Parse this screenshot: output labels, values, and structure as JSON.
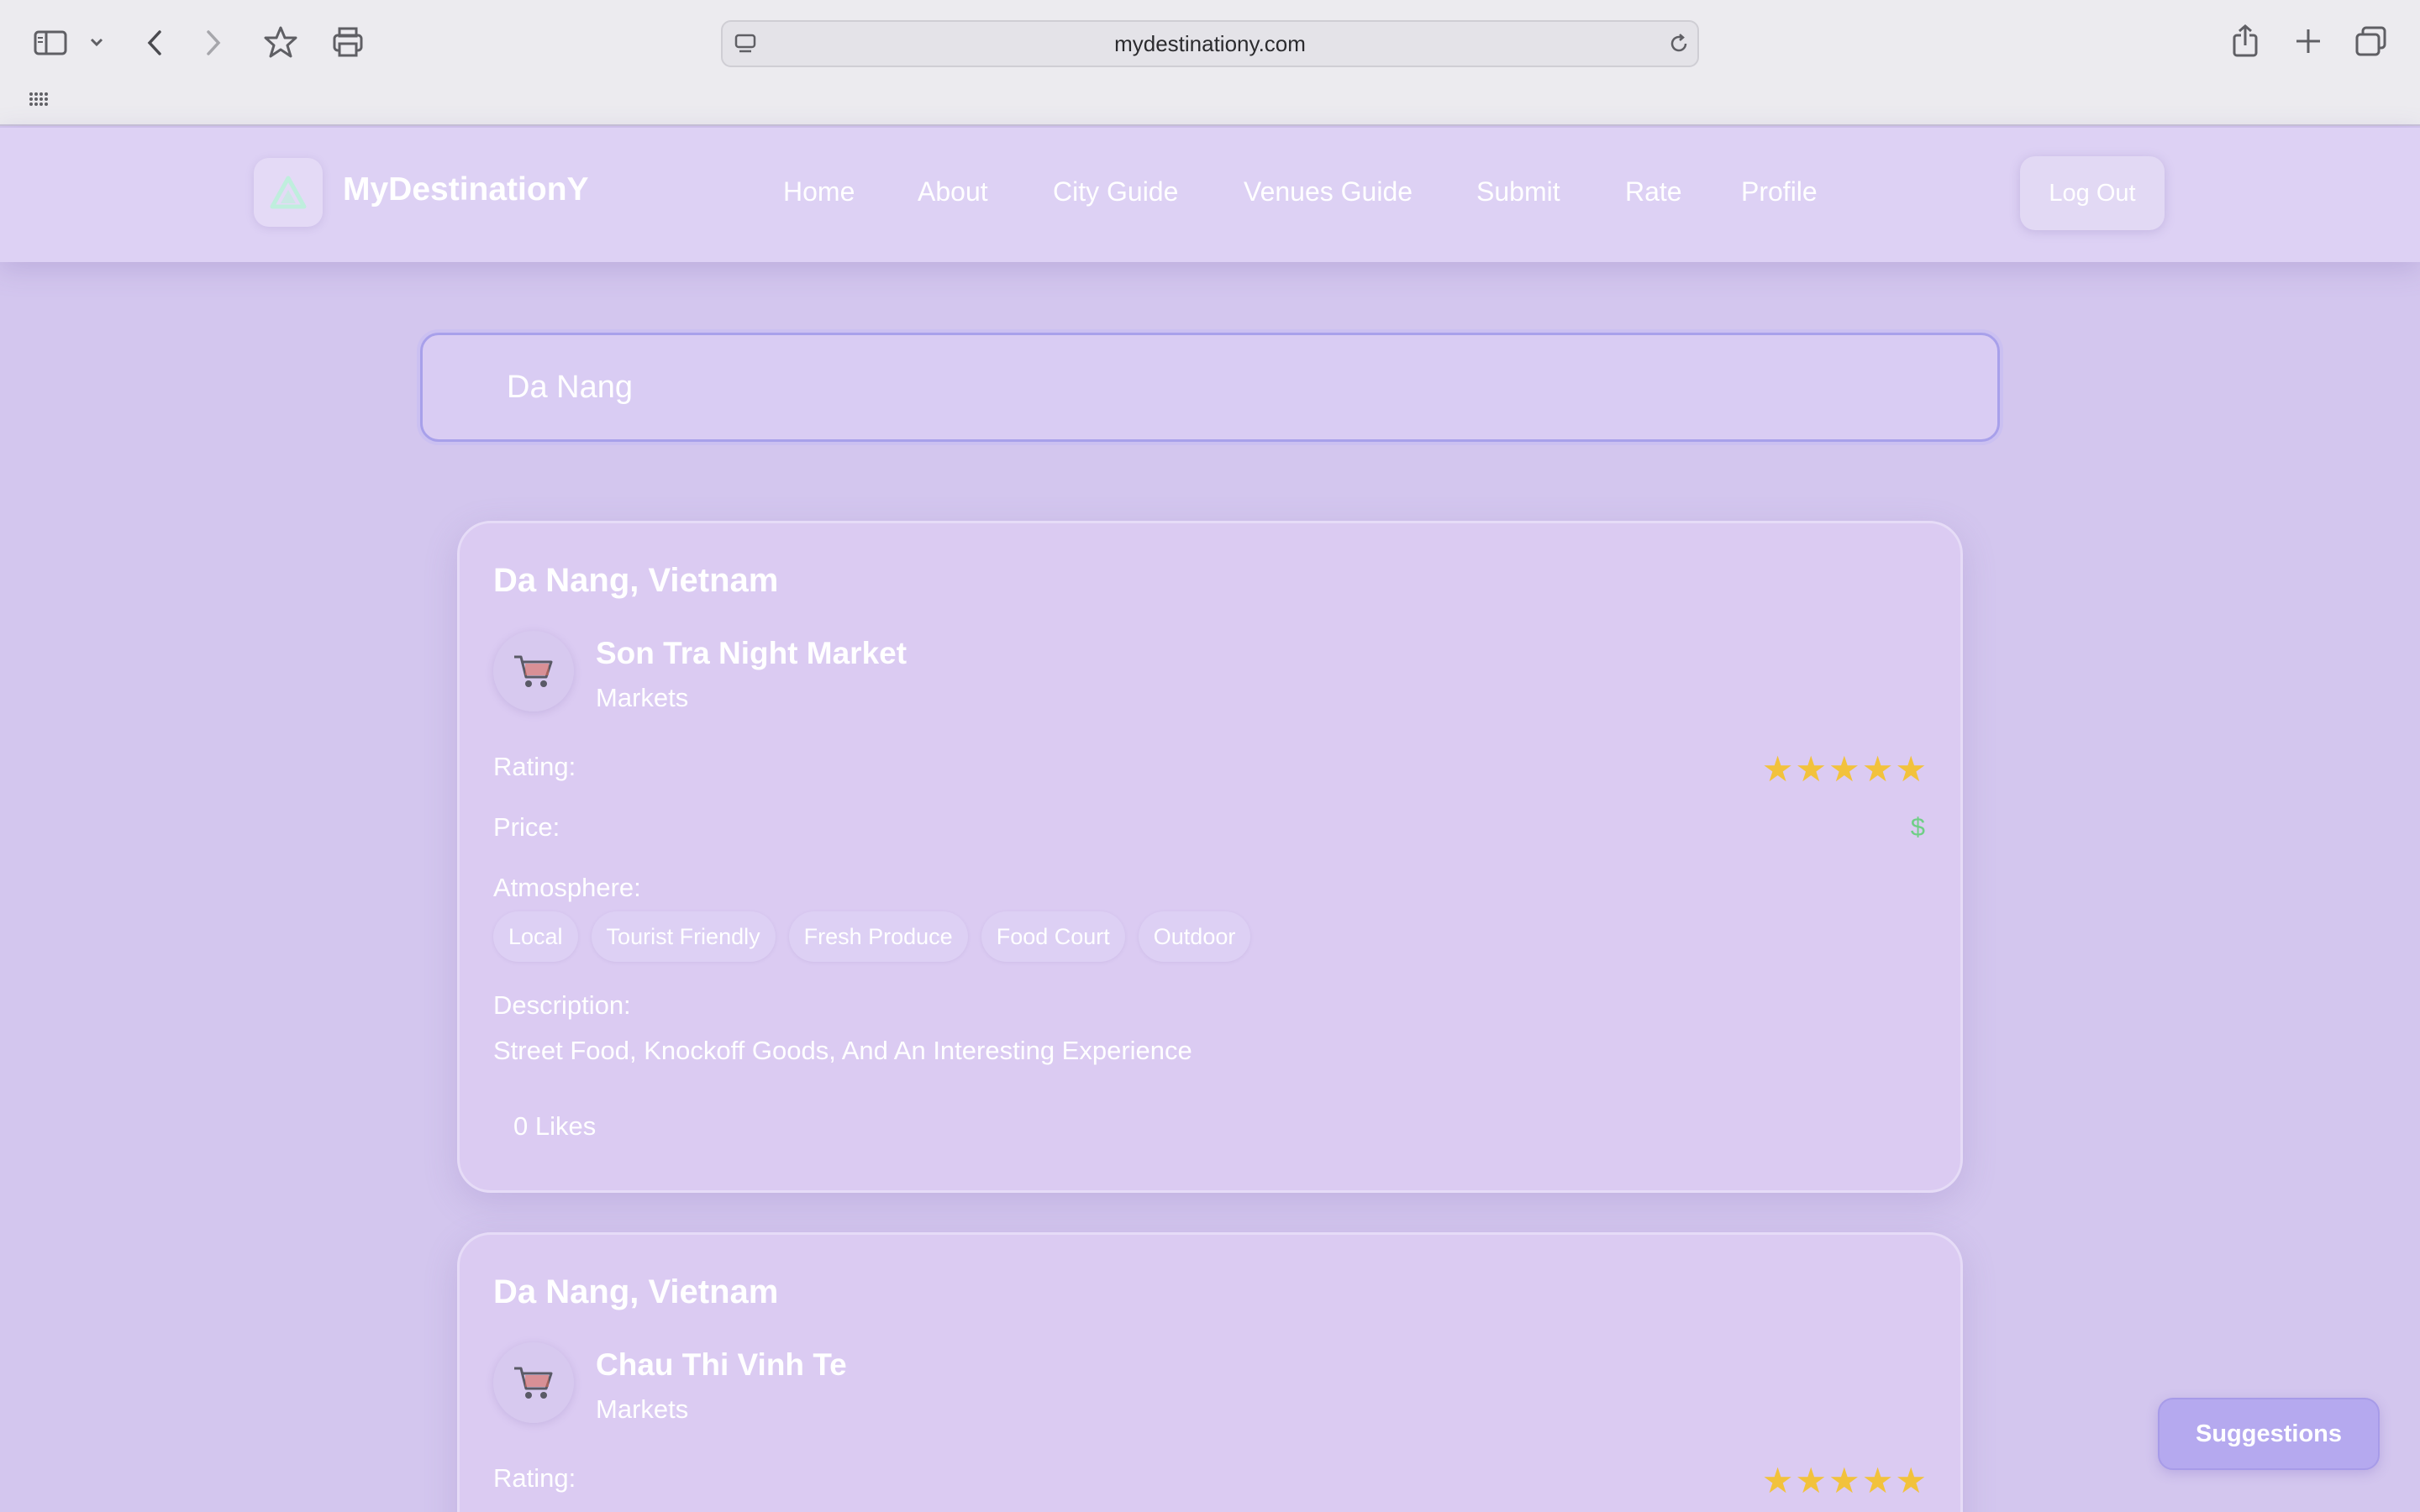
{
  "browser": {
    "url": "mydestinationy.com",
    "icons": [
      "sidebar-icon",
      "chevron-down-icon",
      "back-icon",
      "forward-icon",
      "bookmark-star-icon",
      "print-icon",
      "site-icon",
      "reload-icon",
      "share-icon",
      "new-tab-icon",
      "tabs-overview-icon",
      "grid-icon"
    ]
  },
  "header": {
    "brand": "MyDestinationY",
    "nav": [
      "Home",
      "About",
      "City Guide",
      "Venues Guide",
      "Submit",
      "Rate",
      "Profile"
    ],
    "logout_label": "Log Out"
  },
  "search": {
    "value": "Da Nang"
  },
  "labels": {
    "rating": "Rating:",
    "price": "Price:",
    "atmosphere": "Atmosphere:",
    "description": "Description:"
  },
  "venues": [
    {
      "city": "Da Nang, Vietnam",
      "name": "Son Tra Night Market",
      "category": "Markets",
      "icon": "shopping-cart-icon",
      "rating": 5,
      "price": "$",
      "atmosphere": [
        "Local",
        "Tourist Friendly",
        "Fresh Produce",
        "Food Court",
        "Outdoor"
      ],
      "description": "Street Food, Knockoff Goods, And An Interesting Experience",
      "likes": "0 Likes"
    },
    {
      "city": "Da Nang, Vietnam",
      "name": "Chau Thi Vinh Te",
      "category": "Markets",
      "icon": "shopping-cart-icon",
      "rating": 5
    }
  ],
  "suggestions_label": "Suggestions",
  "colors": {
    "background": "#d3c6ee",
    "star": "#f2c23c",
    "price": "#6fcf86",
    "search_border": "#a8a0ea",
    "suggestions": "#b5a9ef"
  }
}
